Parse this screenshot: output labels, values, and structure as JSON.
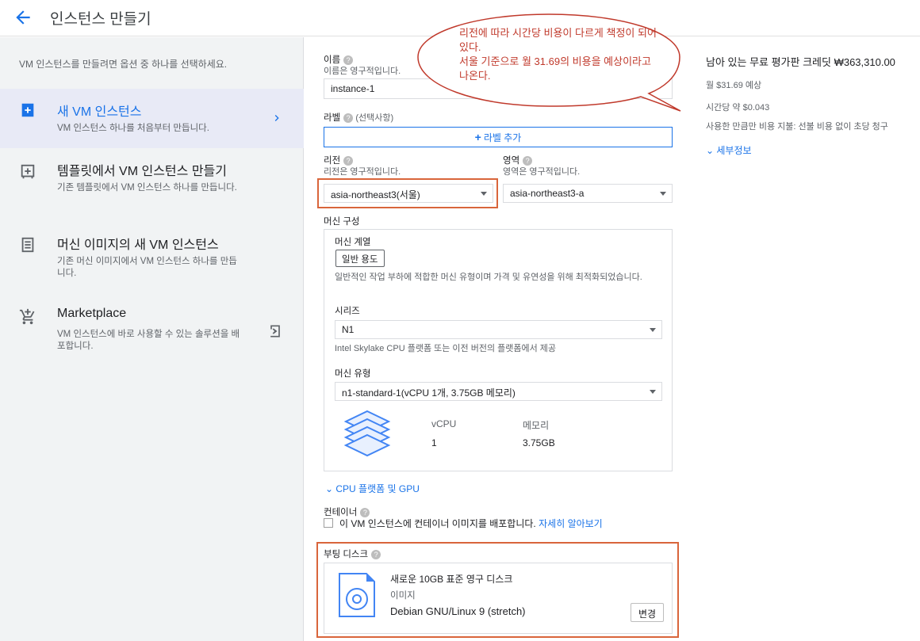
{
  "header": {
    "title": "인스턴스 만들기"
  },
  "left": {
    "intro": "VM 인스턴스를 만들려면 옵션 중 하나를 선택하세요.",
    "options": [
      {
        "title": "새 VM 인스턴스",
        "desc": "VM 인스턴스 하나를 처음부터 만듭니다."
      },
      {
        "title": "템플릿에서 VM 인스턴스 만들기",
        "desc": "기존 템플릿에서 VM 인스턴스 하나를 만듭니다."
      },
      {
        "title": "머신 이미지의 새 VM 인스턴스",
        "desc": "기존 머신 이미지에서 VM 인스턴스 하나를 만듭니다."
      },
      {
        "title": "Marketplace",
        "desc": "VM 인스턴스에 바로 사용할 수 있는 솔루션을 배포합니다."
      }
    ]
  },
  "form": {
    "name_label": "이름",
    "name_sub": "이름은 영구적입니다.",
    "name_value": "instance-1",
    "labels_label": "라벨",
    "labels_optional": "(선택사항)",
    "add_label": "라벨 추가",
    "region_label": "리전",
    "region_sub": "리전은 영구적입니다.",
    "region_value": "asia-northeast3(서울)",
    "zone_label": "영역",
    "zone_sub": "영역은 영구적입니다.",
    "zone_value": "asia-northeast3-a",
    "machine_config_label": "머신 구성",
    "machine_family_label": "머신 계열",
    "machine_family_chip": "일반 용도",
    "machine_family_desc": "일반적인 작업 부하에 적합한 머신 유형이며 가격 및 유연성을 위해 최적화되었습니다.",
    "series_label": "시리즈",
    "series_value": "N1",
    "series_desc": "Intel Skylake CPU 플랫폼 또는 이전 버전의 플랫폼에서 제공",
    "machine_type_label": "머신 유형",
    "machine_type_value": "n1-standard-1(vCPU 1개, 3.75GB 메모리)",
    "vcpu_label": "vCPU",
    "vcpu_value": "1",
    "memory_label": "메모리",
    "memory_value": "3.75GB",
    "cpu_gpu_link": "CPU 플랫폼 및 GPU",
    "container_label": "컨테이너",
    "container_checkbox": "이 VM 인스턴스에 컨테이너 이미지를 배포합니다.",
    "learn_more": "자세히 알아보기",
    "boot_disk_label": "부팅 디스크",
    "boot_disk_title": "새로운 10GB 표준 영구 디스크",
    "boot_disk_image_label": "이미지",
    "boot_disk_image": "Debian GNU/Linux 9 (stretch)",
    "change_button": "변경"
  },
  "right": {
    "credit": "남아 있는 무료 평가판 크레딧 ₩363,310.00",
    "monthly": "월 $31.69 예상",
    "hourly": "시간당 약 $0.043",
    "billing": "사용한 만큼만 비용 지불: 선불 비용 없이 초당 청구",
    "details": "세부정보"
  },
  "callout": {
    "line1": "리전에 따라 시간당 비용이 다르게 책정이 되어 있다.",
    "line2": "서울 기준으로 월 31.69의 비용을 예상이라고 나온다."
  },
  "colors": {
    "accent": "#1a73e8",
    "annotation": "#d9653b",
    "selected_bg": "#e8eaf6"
  }
}
